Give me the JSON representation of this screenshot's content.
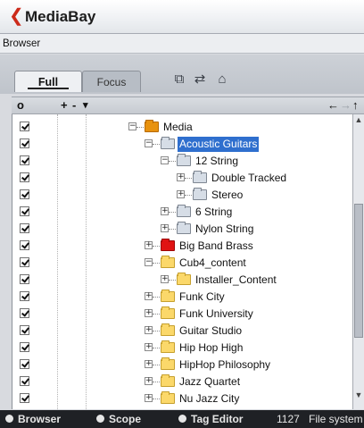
{
  "window": {
    "title": "MediaBay",
    "logo_icon": "cubase-logo-icon"
  },
  "browser_label": "Browser",
  "tabs": [
    {
      "label": "Full",
      "active": true
    },
    {
      "label": "Focus",
      "active": false
    }
  ],
  "toolbar_icons": [
    "copy-icon",
    "link-icon",
    "new-folder-icon"
  ],
  "controls": {
    "toggle": "o",
    "add": "+",
    "remove": "-",
    "menu": "▾",
    "back": "←",
    "forward": "→",
    "up": "↑"
  },
  "tree": {
    "rows": [
      {
        "label": "Media",
        "level": 0,
        "folder": "orange",
        "expander": "-",
        "selected": false
      },
      {
        "label": "Acoustic Guitars",
        "level": 1,
        "folder": "grey",
        "expander": "-",
        "selected": true
      },
      {
        "label": "12 String",
        "level": 2,
        "folder": "grey",
        "expander": "-",
        "selected": false
      },
      {
        "label": "Double Tracked",
        "level": 3,
        "folder": "grey",
        "expander": "+",
        "selected": false
      },
      {
        "label": "Stereo",
        "level": 3,
        "folder": "grey",
        "expander": "+",
        "selected": false
      },
      {
        "label": "6 String",
        "level": 2,
        "folder": "grey",
        "expander": "+",
        "selected": false
      },
      {
        "label": "Nylon String",
        "level": 2,
        "folder": "grey",
        "expander": "+",
        "selected": false
      },
      {
        "label": "Big Band Brass",
        "level": 1,
        "folder": "red",
        "expander": "+",
        "selected": false
      },
      {
        "label": "Cub4_content",
        "level": 1,
        "folder": "yellow",
        "expander": "-",
        "selected": false
      },
      {
        "label": "Installer_Content",
        "level": 2,
        "folder": "yellow",
        "expander": "+",
        "selected": false
      },
      {
        "label": "Funk City",
        "level": 1,
        "folder": "yellow",
        "expander": "+",
        "selected": false
      },
      {
        "label": "Funk University",
        "level": 1,
        "folder": "yellow",
        "expander": "+",
        "selected": false
      },
      {
        "label": "Guitar Studio",
        "level": 1,
        "folder": "yellow",
        "expander": "+",
        "selected": false
      },
      {
        "label": "Hip Hop High",
        "level": 1,
        "folder": "yellow",
        "expander": "+",
        "selected": false
      },
      {
        "label": "HipHop Philosophy",
        "level": 1,
        "folder": "yellow",
        "expander": "+",
        "selected": false
      },
      {
        "label": "Jazz Quartet",
        "level": 1,
        "folder": "yellow",
        "expander": "+",
        "selected": false
      },
      {
        "label": "Nu Jazz City",
        "level": 1,
        "folder": "yellow",
        "expander": "+",
        "selected": false
      }
    ]
  },
  "statusbar": {
    "browser": "Browser",
    "scope": "Scope",
    "tag_editor": "Tag Editor",
    "count": "1127",
    "info": "File system"
  },
  "colors": {
    "selection": "#2f6fce",
    "accent": "#cc2a1a",
    "statusbar_bg": "#1f2125"
  }
}
